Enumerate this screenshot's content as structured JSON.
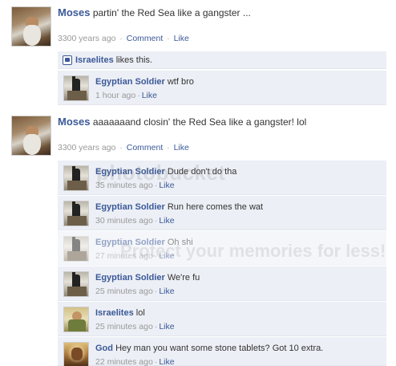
{
  "posts": [
    {
      "author": "Moses",
      "message": "partin' the Red Sea like a gangster ...",
      "time": "3300 years ago",
      "comment_label": "Comment",
      "like_label": "Like",
      "likes": {
        "name": "Israelites",
        "text": "likes this."
      },
      "comments": [
        {
          "author": "Egyptian Soldier",
          "text": "wtf bro",
          "time": "1 hour ago",
          "like_label": "Like"
        }
      ]
    },
    {
      "author": "Moses",
      "message": "aaaaaaand closin' the Red Sea like a gangster! lol",
      "time": "3300 years ago",
      "comment_label": "Comment",
      "like_label": "Like",
      "comments": [
        {
          "author": "Egyptian Soldier",
          "text": "Dude don't do tha",
          "time": "35 minutes ago",
          "like_label": "Like"
        },
        {
          "author": "Egyptian Soldier",
          "text": "Run here comes the wat",
          "time": "30 minutes ago",
          "like_label": "Like"
        },
        {
          "author": "Egyptian Soldier",
          "text": "Oh shi",
          "time": "27 minutes ago",
          "like_label": "Like"
        },
        {
          "author": "Egyptian Soldier",
          "text": "We're fu",
          "time": "25 minutes ago",
          "like_label": "Like"
        },
        {
          "author": "Israelites",
          "text": "lol",
          "time": "25 minutes ago",
          "like_label": "Like"
        },
        {
          "author": "God",
          "text": "Hey man you want some stone tablets?  Got 10 extra.",
          "time": "22 minutes ago",
          "like_label": "Like"
        }
      ]
    }
  ],
  "watermark": {
    "line1": "photobucket",
    "line2": "Protect your memories for less!"
  }
}
